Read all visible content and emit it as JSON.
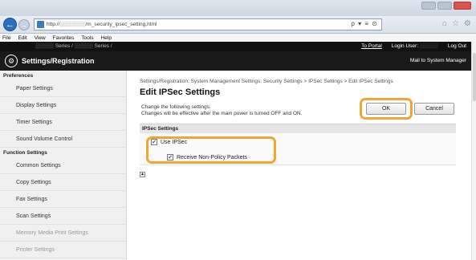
{
  "browser": {
    "address": "http://░░░░░░░/m_security_ipsec_setting.html",
    "addr_tools": "ρ ▾ ≡ ⊙",
    "nav_icons": [
      "⌂",
      "☆",
      "⚙"
    ],
    "menu": [
      "File",
      "Edit",
      "View",
      "Favorites",
      "Tools",
      "Help"
    ]
  },
  "header": {
    "model": "░░░░░ Series / ░░░░░ Series /",
    "to_portal": "To Portal",
    "login_user": "Login User:",
    "login_name": "░░░░░",
    "logout": "Log Out",
    "app_title": "Settings/Registration",
    "mail": "Mail to System Manager"
  },
  "sidebar": {
    "preferences_label": "Preferences",
    "preferences": [
      "Paper Settings",
      "Display Settings",
      "Timer Settings",
      "Sound Volume Control"
    ],
    "function_label": "Function Settings",
    "functions": [
      "Common Settings",
      "Copy Settings",
      "Fax Settings",
      "Scan Settings",
      "Memory Media Print Settings",
      "Printer Settings"
    ]
  },
  "main": {
    "breadcrumb": "Settings/Registration: System Management Settings: Security Settings > IPSec Settings > Edit IPSec Settings",
    "title": "Edit IPSec Settings",
    "desc_line1": "Change the following settings.",
    "desc_line2": "Changes will be effective after the main power is turned OFF and ON.",
    "ok_label": "OK",
    "cancel_label": "Cancel",
    "section_label": "IPSec Settings",
    "use_ipsec_label": "Use IPSec",
    "use_ipsec_checked": true,
    "non_policy_label": "Receive Non-Policy Packets",
    "non_policy_checked": true,
    "check_glyph": "✔",
    "top_glyph": "▲"
  },
  "colors": {
    "highlight": "#f1a533",
    "header_bg": "#1a1a1a",
    "back_button": "#2f6fc0"
  }
}
